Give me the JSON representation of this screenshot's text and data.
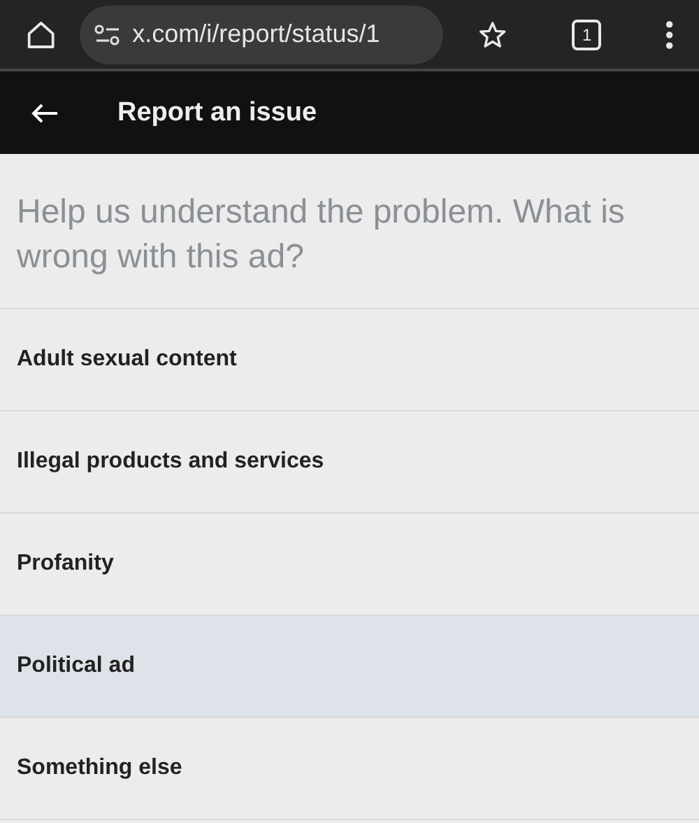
{
  "browser": {
    "url": "x.com/i/report/status/1",
    "tab_count": "1"
  },
  "header": {
    "title": "Report an issue"
  },
  "question": "Help us understand the problem. What is wrong with this ad?",
  "options": [
    {
      "label": "Adult sexual content",
      "selected": false
    },
    {
      "label": "Illegal products and services",
      "selected": false
    },
    {
      "label": "Profanity",
      "selected": false
    },
    {
      "label": "Political ad",
      "selected": true
    },
    {
      "label": "Something else",
      "selected": false
    }
  ]
}
